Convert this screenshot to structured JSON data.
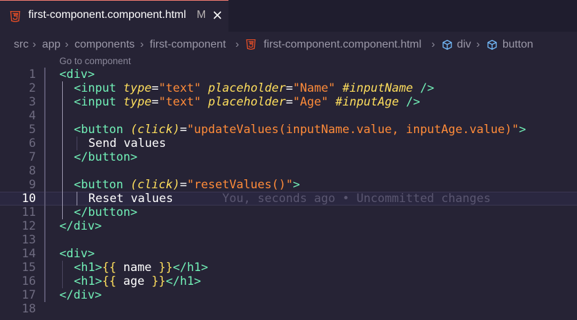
{
  "tab": {
    "filename": "first-component.component.html",
    "modified_badge": "M"
  },
  "breadcrumb": {
    "items": [
      "src",
      "app",
      "components",
      "first-component",
      "first-component.component.html",
      "div",
      "button"
    ]
  },
  "codelens": "Go to component",
  "line_numbers": [
    "1",
    "2",
    "3",
    "4",
    "5",
    "6",
    "7",
    "8",
    "9",
    "10",
    "11",
    "12",
    "13",
    "14",
    "15",
    "16",
    "17",
    "18"
  ],
  "active_line": "10",
  "blame": "You, seconds ago • Uncommitted changes",
  "code": {
    "l1": "<div>",
    "l2a": "<input",
    "l2b": "type",
    "l2c": "=",
    "l2d": "\"text\"",
    "l2e": "placeholder",
    "l2f": "=",
    "l2g": "\"Name\"",
    "l2h": "#inputName",
    "l2i": "/>",
    "l3a": "<input",
    "l3b": "type",
    "l3c": "=",
    "l3d": "\"text\"",
    "l3e": "placeholder",
    "l3f": "=",
    "l3g": "\"Age\"",
    "l3h": "#inputAge",
    "l3i": "/>",
    "l5a": "<button",
    "l5b": "(click)",
    "l5c": "=",
    "l5d": "\"updateValues(inputName.value, inputAge.value)\"",
    "l5e": ">",
    "l6": "Send values",
    "l7": "</button>",
    "l9a": "<button",
    "l9b": "(click)",
    "l9c": "=",
    "l9d": "\"resetValues()\"",
    "l9e": ">",
    "l10": "Reset values",
    "l11": "</button>",
    "l12": "</div>",
    "l14": "<div>",
    "l15a": "<h1>",
    "l15b": "{{",
    "l15c": " name ",
    "l15d": "}}",
    "l15e": "</h1>",
    "l16a": "<h1>",
    "l16b": "{{",
    "l16c": " age ",
    "l16d": "}}",
    "l16e": "</h1>",
    "l17": "</div>"
  },
  "colors": {
    "editor_bg": "#262335",
    "tag": "#72f1b8",
    "attribute": "#fede5d",
    "string": "#ff8b39",
    "accent_border": "#f97e72"
  }
}
